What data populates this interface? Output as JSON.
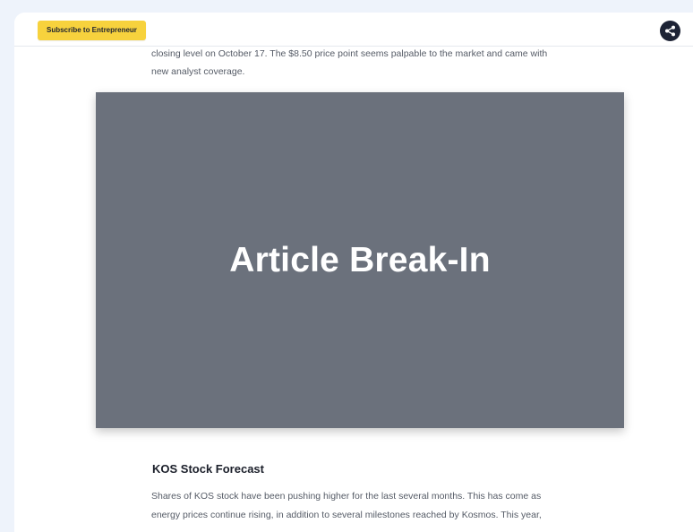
{
  "header": {
    "subscribe_label": "Subscribe to Entrepreneur",
    "share_icon": "share-icon",
    "share_button_color": "#1d2335",
    "subscribe_button_color": "#f7d23d"
  },
  "article": {
    "intro_lines": [
      "closing level on October 17. The $8.50 price point seems palpable to the market and came with",
      "new analyst coverage."
    ],
    "break_in": {
      "label": "Article Break-In",
      "background": "#6b717c"
    },
    "section_heading": "KOS Stock Forecast",
    "section_lines": [
      "Shares of KOS stock have been pushing higher for the last several months. This has come as",
      "energy prices continue rising, in addition to several milestones reached by Kosmos. This year,"
    ]
  }
}
